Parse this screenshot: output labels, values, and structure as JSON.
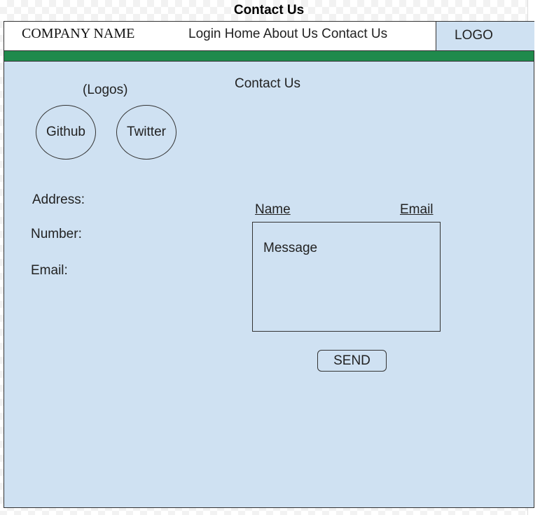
{
  "page": {
    "title": "Contact Us"
  },
  "header": {
    "company_name": "COMPANY NAME",
    "nav": [
      "Login",
      "Home",
      "About Us",
      "Contact Us"
    ],
    "logo": "LOGO"
  },
  "main": {
    "heading": "Contact Us",
    "logos_label": "(Logos)",
    "social": [
      "Github",
      "Twitter"
    ],
    "contact_info": [
      "Address:",
      "Number:",
      "Email:"
    ],
    "form": {
      "name_label": "Name",
      "email_label": "Email",
      "message_placeholder": "Message",
      "send_label": "SEND"
    }
  },
  "colors": {
    "frame_bg": "#cfe1f2",
    "green_bar": "#1f8a4c",
    "border": "#333333"
  }
}
